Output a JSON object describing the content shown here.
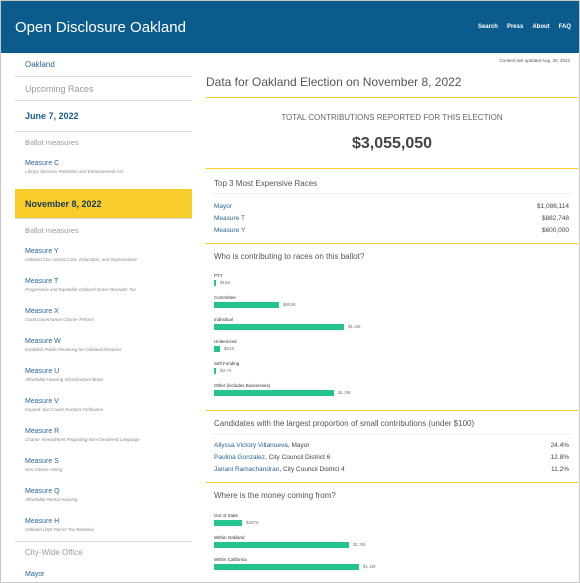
{
  "header": {
    "brand": "Open Disclosure Oakland",
    "nav": [
      "Search",
      "Press",
      "About",
      "FAQ"
    ]
  },
  "sidebar": {
    "city": "Oakland",
    "upcoming": "Upcoming Races",
    "dates": [
      {
        "label": "June 7, 2022",
        "active": false,
        "section": "Ballot measures",
        "items": [
          {
            "title": "Measure C",
            "desc": "Library Services Retention and Enhancement Act"
          }
        ]
      },
      {
        "label": "November 8, 2022",
        "active": true,
        "section": "Ballot measures",
        "items": [
          {
            "title": "Measure Y",
            "desc": "Oakland Zoo Animal Care, Education, and Improvement"
          },
          {
            "title": "Measure T",
            "desc": "Progressive and Equitable Oakland Gross Receipts Tax"
          },
          {
            "title": "Measure X",
            "desc": "Good Governance Charter Reform"
          },
          {
            "title": "Measure W",
            "desc": "Establish Public Financing for Oakland Elections"
          },
          {
            "title": "Measure U",
            "desc": "Affordable Housing Infrastructure Bond"
          },
          {
            "title": "Measure V",
            "desc": "Expand Just Cause Eviction Ordinance"
          },
          {
            "title": "Measure R",
            "desc": "Charter Amendment Regarding Non-Gendered Language"
          },
          {
            "title": "Measure S",
            "desc": "Non-Citizen Voting"
          },
          {
            "title": "Measure Q",
            "desc": "Affordable Rental Housing"
          },
          {
            "title": "Measure H",
            "desc": "Oakland USD Parcel Tax Renewal"
          }
        ]
      }
    ],
    "citywide": "City-Wide Office",
    "citywide_items": [
      "Mayor"
    ]
  },
  "main": {
    "updated": "Content last updated Aug. 30, 2022",
    "title": "Data for Oakland Election on November 8, 2022",
    "total_label": "TOTAL CONTRIBUTIONS REPORTED FOR THIS ELECTION",
    "total_value": "$3,055,050",
    "top3": {
      "heading": "Top 3 Most Expensive Races",
      "rows": [
        {
          "name": "Mayor",
          "value": "$1,086,114"
        },
        {
          "name": "Measure T",
          "value": "$882,748"
        },
        {
          "name": "Measure Y",
          "value": "$600,000"
        }
      ]
    },
    "contributors": {
      "heading": "Who is contributing to races on this ballot?",
      "bars": [
        {
          "label": "PTY",
          "value": "$16K",
          "amount": 16
        },
        {
          "label": "Committee",
          "value": "$653K",
          "amount": 653
        },
        {
          "label": "Individual",
          "value": "$1.3M",
          "amount": 1300
        },
        {
          "label": "Unitemized",
          "value": "$61K",
          "amount": 61
        },
        {
          "label": "Self Funding",
          "value": "$3.7K",
          "amount": 3.7
        },
        {
          "label": "Other (includes Businesses)",
          "value": "$1.2M",
          "amount": 1200
        }
      ]
    },
    "small": {
      "heading": "Candidates with the largest proportion of small contributions (under $100)",
      "rows": [
        {
          "name": "Allyssa Victory Villanueva",
          "office": ", Mayor",
          "value": "24.4%"
        },
        {
          "name": "Paulina Gonzalez",
          "office": ", City Council District 6",
          "value": "12.8%"
        },
        {
          "name": "Janani Ramachandran",
          "office": ", City Council District 4",
          "value": "11.2%"
        }
      ]
    },
    "location": {
      "heading": "Where is the money coming from?",
      "bars": [
        {
          "label": "Out of State",
          "value": "$267K",
          "amount": 267
        },
        {
          "label": "Within Oakland",
          "value": "$1.3M",
          "amount": 1300
        },
        {
          "label": "Within California",
          "value": "$1.4M",
          "amount": 1400
        }
      ]
    }
  },
  "colors": {
    "header_bg": "#0b5c8c",
    "accent_yellow": "#f8cd2b",
    "bar_green": "#25c48a",
    "link_blue": "#2a6496"
  }
}
